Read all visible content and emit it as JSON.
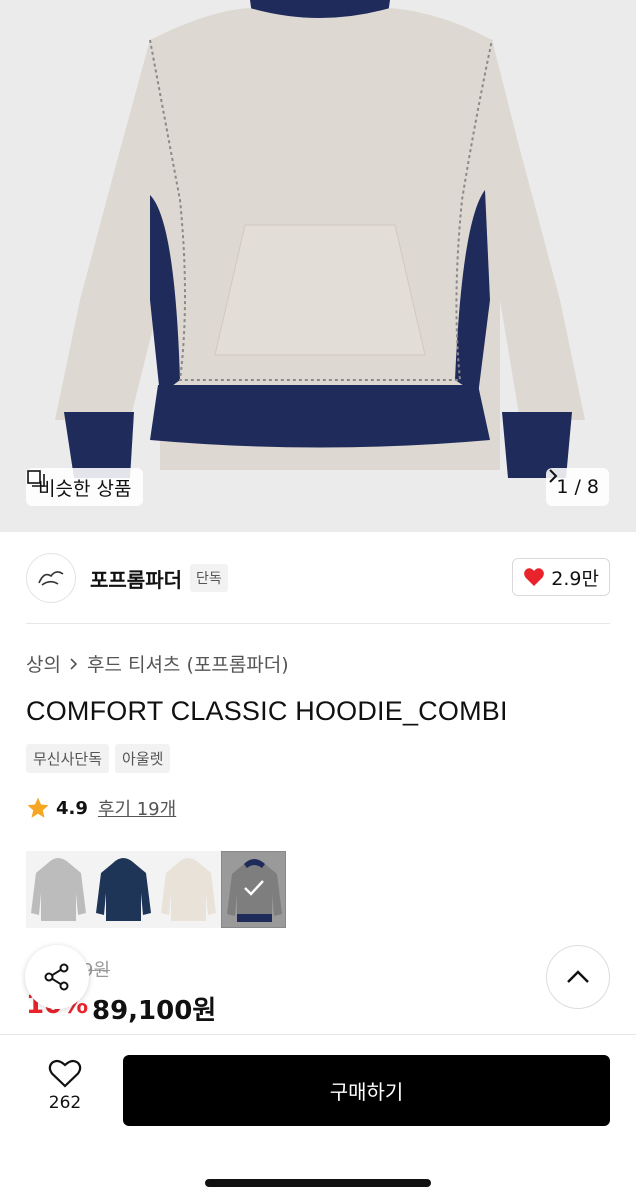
{
  "hero": {
    "similar_label": "비슷한 상품",
    "pager_text": "1 / 8",
    "image_alt_icon": "hoodie-product-photo"
  },
  "brand": {
    "name": "포프롬파더",
    "badge": "단독",
    "likes": "2.9만",
    "logo_icon": "brand-logo-icon"
  },
  "product": {
    "breadcrumb": [
      "상의",
      "후드 티셔츠 (포프롬파더)"
    ],
    "title": "COMFORT CLASSIC HOODIE_COMBI",
    "tags": [
      "무신사단독",
      "아울렛"
    ],
    "rating": "4.9",
    "reviews": "후기 19개",
    "swatch_names": [
      "gray-hoodie",
      "navy-hoodie",
      "ivory-hoodie",
      "combi-hoodie"
    ],
    "original_price_visible": "9원",
    "discount": "10%",
    "sale_price": "89,100원"
  },
  "bottom": {
    "wish_count": "262",
    "buy_label": "구매하기"
  },
  "colors": {
    "accent_red": "#e8232b",
    "star": "#f5a623",
    "navy": "#1f2b5a",
    "buy_button": "#000000"
  }
}
